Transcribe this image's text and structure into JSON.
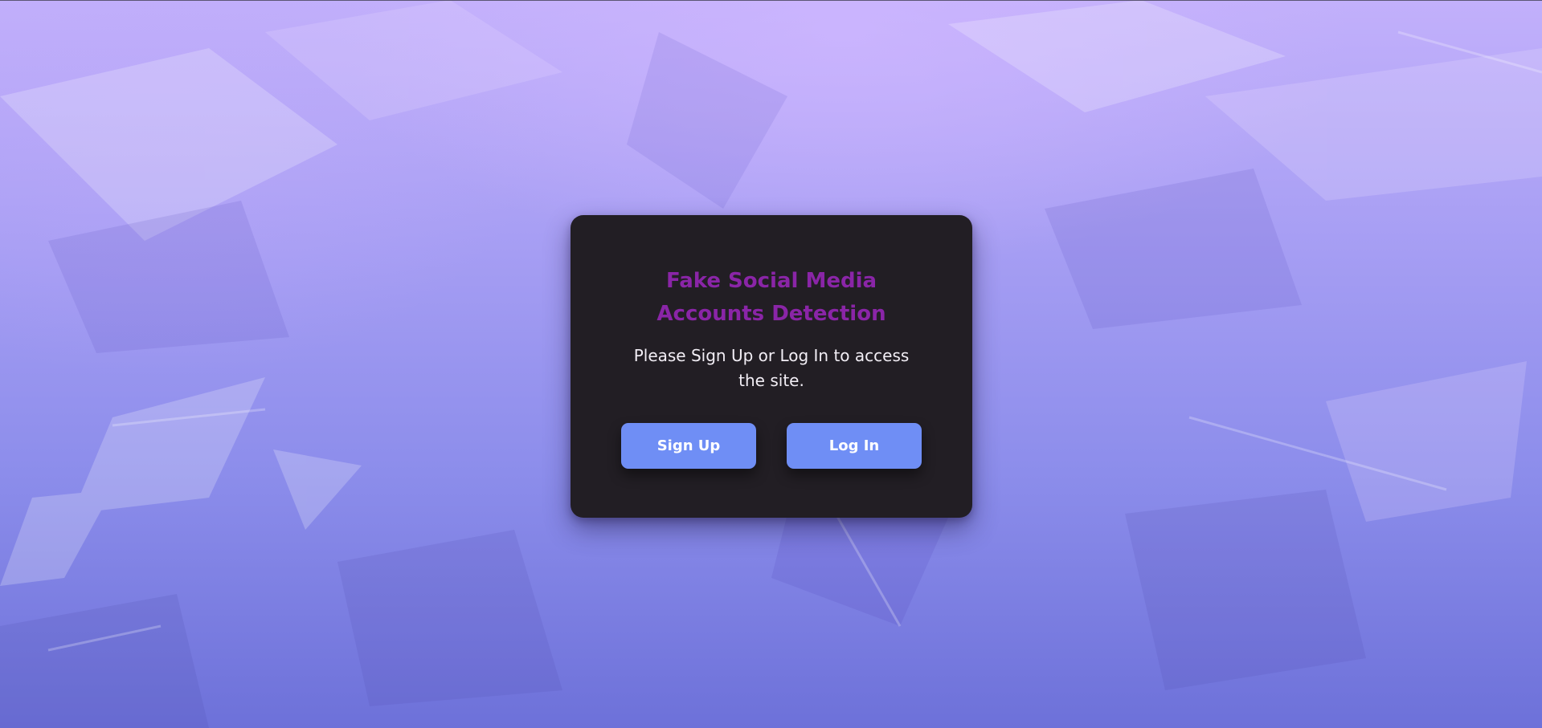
{
  "page": {
    "background_colors": [
      "#c2b0fb",
      "#a59df3",
      "#8c8deb",
      "#6d71d9"
    ]
  },
  "card": {
    "title_lines": [
      "Fake Social Media",
      "Accounts Detection"
    ],
    "title_color": "#8a25a7",
    "subtitle_lines": [
      "Please Sign Up or Log In to access",
      "the site."
    ],
    "background_color": "#221e24"
  },
  "buttons": {
    "signup_label": "Sign Up",
    "login_label": "Log In",
    "color": "#6f8ef5"
  }
}
